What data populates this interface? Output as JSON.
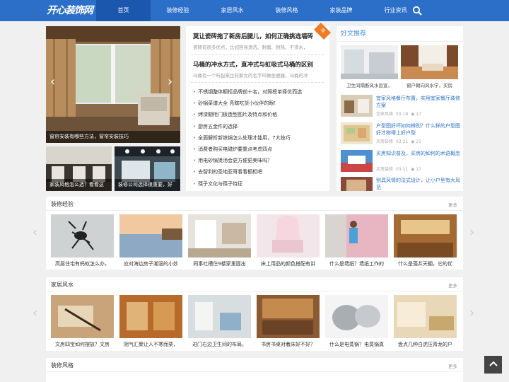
{
  "site": {
    "logo": "开心装饰网"
  },
  "nav": {
    "items": [
      "首页",
      "装修经验",
      "家居风水",
      "装修风格",
      "家装品牌",
      "行业资讯"
    ],
    "active": 0
  },
  "slider": {
    "caption": "窗帘安装有哪些方法，窗帘安装技巧",
    "prev": "‹",
    "next": "›"
  },
  "subpics": [
    {
      "caption": "家装风格怎么选？看看这"
    },
    {
      "caption": "装修公司选择很重要，好"
    }
  ],
  "headline": {
    "items": [
      {
        "title": "莫让瓷砖拖了新房后腿儿，如何正确挑选墙砖",
        "desc": "瓷砖有很多优点，比如容易清洗、耐磨、耐热、不渗水，"
      },
      {
        "title": "马桶的冲水方式，直冲式与虹吸式马桶的区别",
        "desc": "马桶有一个听起来比较斯文的名字叫做坐便器，马桶的冲"
      }
    ],
    "badge": "荐",
    "list": [
      "不锈钢整体橱柜品牌前十名，对照榜单择优而选",
      "砂锅菜谱大全 亮瞎吃货小伙伴的眼!",
      "烤漆橱柜门板造型图片及特点和价格",
      "厨房五金件的选择",
      "全面解析新铁锅怎么处理才能用，7大技巧",
      "消费者购买电磁炉要重点考虑四点",
      "用电砂锅煲汤会更方便更美味吗？",
      "去智利的圣地亚哥看看橱柜吧",
      "筷子文化与筷子特征"
    ]
  },
  "side": {
    "title": "好文推荐",
    "pics": [
      {
        "caption": "卫生间隔断风水忌宣，"
      },
      {
        "caption": "窗户朝向风水学，买房"
      }
    ],
    "articles": [
      {
        "title": "宜家风格餐厅布置，实用宜家餐厅装修方案",
        "cat": "宜家风格",
        "date": "03-18",
        "views": "17"
      },
      {
        "title": "户型图好坏如何辨别？什么样的户型图好才称得上好户型",
        "cat": "买房装修",
        "date": "03-21",
        "views": "21"
      },
      {
        "title": "买房知识普及，买房的如何的术语概念",
        "cat": "买房装修",
        "date": "03-11",
        "views": "17"
      },
      {
        "title": "别具风情的法式设计，让小户型有大风范",
        "cat": "",
        "date": "",
        "views": ""
      }
    ]
  },
  "sections": [
    {
      "title": "装修经验",
      "more": "更多",
      "items": [
        "高层住宅有蚂蚁怎么办，",
        "应对海边房子潮湿的小妙",
        "同事吐槽住9楼家里面出",
        "床上用品的颜色搭配有讲",
        "什么是墙纸？墙纸工作的",
        "什么是藻井天棚，它的优"
      ]
    },
    {
      "title": "家居风水",
      "more": "更多",
      "items": [
        "文房四宝如何摆放？文房",
        "阴气汇聚让人不寒而栗，",
        "进门右边卫生间的布局，",
        "书房书桌对着床好不好？",
        "什么是电蒸锅？电蒸锅真",
        "盘点几种白虎压青龙的户"
      ]
    },
    {
      "title": "装修风格",
      "more": "更多",
      "items": []
    }
  ],
  "colors": {
    "brand": "#2c6fc9",
    "brand_dark": "#1b58ad",
    "link": "#2c6fc9",
    "badge": "#f07b24"
  },
  "icons": {
    "search": "search-icon",
    "views": "eye-icon",
    "top": "arrow-up-icon"
  }
}
